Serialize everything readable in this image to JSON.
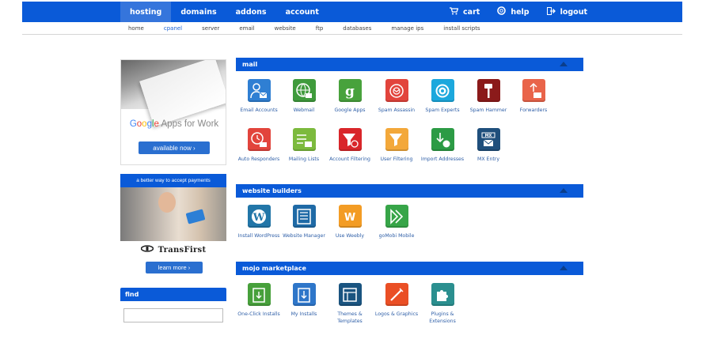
{
  "topnav": {
    "tabs": [
      {
        "label": "hosting",
        "active": true
      },
      {
        "label": "domains",
        "active": false
      },
      {
        "label": "addons",
        "active": false
      },
      {
        "label": "account",
        "active": false
      }
    ],
    "right": [
      {
        "label": "cart",
        "icon": "cart-icon"
      },
      {
        "label": "help",
        "icon": "help-icon"
      },
      {
        "label": "logout",
        "icon": "logout-icon"
      }
    ]
  },
  "subnav": {
    "items": [
      {
        "label": "home",
        "active": false
      },
      {
        "label": "cpanel",
        "active": true
      },
      {
        "label": "server",
        "active": false
      },
      {
        "label": "email",
        "active": false
      },
      {
        "label": "website",
        "active": false
      },
      {
        "label": "ftp",
        "active": false
      },
      {
        "label": "databases",
        "active": false
      },
      {
        "label": "manage ips",
        "active": false
      },
      {
        "label": "install scripts",
        "active": false
      }
    ]
  },
  "sidebar": {
    "google_ad": {
      "brand": "Google",
      "product": " Apps for Work",
      "button": "available now"
    },
    "payments_ad": {
      "header": "a better way to accept payments",
      "logo": "TransFirst",
      "button": "learn more"
    },
    "find": {
      "header": "find",
      "placeholder": ""
    }
  },
  "sections": {
    "mail": {
      "title": "mail",
      "items": [
        {
          "label": "Email Accounts",
          "icon": "email-accounts-icon",
          "color": "#2f7fd3"
        },
        {
          "label": "Webmail",
          "icon": "webmail-icon",
          "color": "#3f9b3c"
        },
        {
          "label": "Google Apps",
          "icon": "google-apps-icon",
          "color": "#48a23c"
        },
        {
          "label": "Spam Assassin",
          "icon": "spam-assassin-icon",
          "color": "#e2443c"
        },
        {
          "label": "Spam Experts",
          "icon": "spam-experts-icon",
          "color": "#1ca8dd"
        },
        {
          "label": "Spam Hammer",
          "icon": "spam-hammer-icon",
          "color": "#8b1a1a"
        },
        {
          "label": "Forwarders",
          "icon": "forwarders-icon",
          "color": "#e9644a"
        },
        {
          "label": "Auto Responders",
          "icon": "auto-responders-icon",
          "color": "#e2443c"
        },
        {
          "label": "Mailing Lists",
          "icon": "mailing-lists-icon",
          "color": "#7cba3d"
        },
        {
          "label": "Account Filtering",
          "icon": "account-filtering-icon",
          "color": "#d9262a"
        },
        {
          "label": "User Filtering",
          "icon": "user-filtering-icon",
          "color": "#f3a83a"
        },
        {
          "label": "Import Addresses",
          "icon": "import-addresses-icon",
          "color": "#2c9b45"
        },
        {
          "label": "MX Entry",
          "icon": "mx-entry-icon",
          "color": "#1f4f7c"
        }
      ]
    },
    "website_builders": {
      "title": "website builders",
      "items": [
        {
          "label": "Install WordPress",
          "icon": "wordpress-icon",
          "color": "#2276a8"
        },
        {
          "label": "Website Manager",
          "icon": "website-manager-icon",
          "color": "#1f6aa6"
        },
        {
          "label": "Use Weebly",
          "icon": "weebly-icon",
          "color": "#f39c24"
        },
        {
          "label": "goMobi Mobile",
          "icon": "gomobi-icon",
          "color": "#37a548"
        }
      ]
    },
    "mojo_marketplace": {
      "title": "mojo marketplace",
      "items": [
        {
          "label": "One-Click Installs",
          "icon": "one-click-installs-icon",
          "color": "#47a03b"
        },
        {
          "label": "My Installs",
          "icon": "my-installs-icon",
          "color": "#2e76c9"
        },
        {
          "label": "Themes & Templates",
          "icon": "themes-templates-icon",
          "color": "#1a5480"
        },
        {
          "label": "Logos & Graphics",
          "icon": "logos-graphics-icon",
          "color": "#ea4f25"
        },
        {
          "label": "Plugins & Extensions",
          "icon": "plugins-extensions-icon",
          "color": "#2b8f8f"
        }
      ]
    }
  }
}
